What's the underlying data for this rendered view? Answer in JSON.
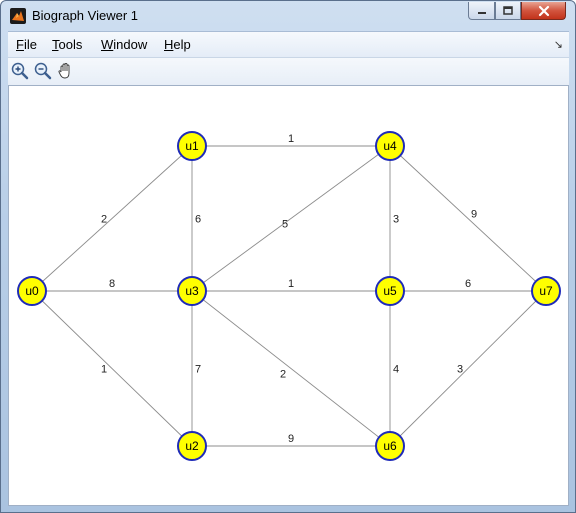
{
  "window": {
    "title": "Biograph Viewer 1"
  },
  "menu": {
    "items": [
      {
        "key": "F",
        "rest": "ile"
      },
      {
        "key": "T",
        "rest": "ools"
      },
      {
        "key": "W",
        "rest": "indow"
      },
      {
        "key": "H",
        "rest": "elp"
      }
    ],
    "dock_arrow": "↘"
  },
  "toolbar": {
    "tools": [
      "zoom-in-icon",
      "zoom-out-icon",
      "pan-hand-icon"
    ]
  },
  "graph": {
    "node_fill": "#ffff00",
    "node_stroke": "#1f2bb8",
    "edge_color": "#8c8c8c",
    "nodes": [
      "u0",
      "u1",
      "u2",
      "u3",
      "u4",
      "u5",
      "u6",
      "u7"
    ],
    "edges": [
      {
        "from": "u0",
        "to": "u1",
        "weight": "2"
      },
      {
        "from": "u0",
        "to": "u3",
        "weight": "8"
      },
      {
        "from": "u0",
        "to": "u2",
        "weight": "1"
      },
      {
        "from": "u1",
        "to": "u4",
        "weight": "1"
      },
      {
        "from": "u1",
        "to": "u3",
        "weight": "6"
      },
      {
        "from": "u3",
        "to": "u4",
        "weight": "5"
      },
      {
        "from": "u3",
        "to": "u5",
        "weight": "1"
      },
      {
        "from": "u3",
        "to": "u2",
        "weight": "7"
      },
      {
        "from": "u3",
        "to": "u6",
        "weight": "2"
      },
      {
        "from": "u4",
        "to": "u5",
        "weight": "3"
      },
      {
        "from": "u4",
        "to": "u7",
        "weight": "9"
      },
      {
        "from": "u5",
        "to": "u7",
        "weight": "6"
      },
      {
        "from": "u5",
        "to": "u6",
        "weight": "4"
      },
      {
        "from": "u2",
        "to": "u6",
        "weight": "9"
      },
      {
        "from": "u6",
        "to": "u7",
        "weight": "3"
      }
    ]
  }
}
